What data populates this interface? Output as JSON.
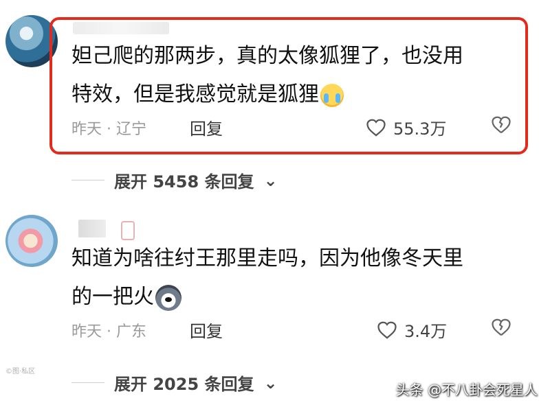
{
  "comments": [
    {
      "text_line1": "妲己爬的那两步，真的太像狐狸了，也没用",
      "text_line2": "特效，但是我感觉就是狐狸",
      "date_location": "昨天 · 辽宁",
      "reply_label": "回复",
      "likes": "55.3万",
      "expand_label": "展开 5458 条回复"
    },
    {
      "text_line1": "知道为啥往纣王那里走吗，因为他像冬天里",
      "text_line2": "的一把火",
      "date_location": "昨天 · 广东",
      "reply_label": "回复",
      "likes": "3.4万",
      "expand_label": "展开 2025 条回复"
    }
  ],
  "watermark": "头条 @不八卦会死星人",
  "watermark_left": "©图·私区",
  "colors": {
    "highlight": "#e32a1d",
    "meta": "#9a9a9a",
    "text": "#111111"
  }
}
